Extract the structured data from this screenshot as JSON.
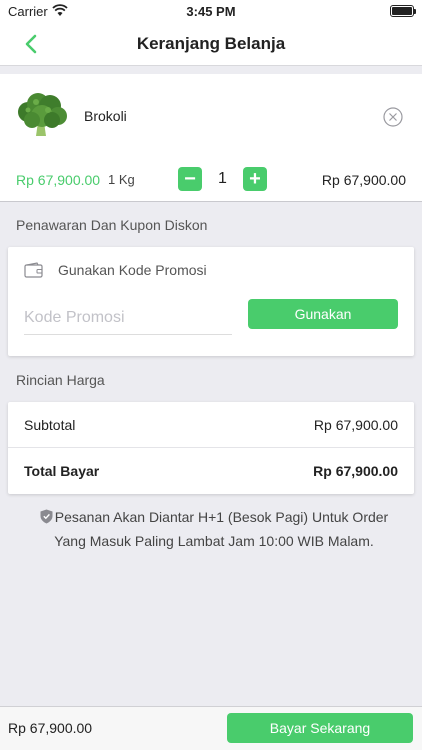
{
  "status_bar": {
    "carrier": "Carrier",
    "time": "3:45 PM",
    "wifi_icon": "wifi-icon",
    "battery_icon": "battery-icon"
  },
  "nav": {
    "title": "Keranjang Belanja",
    "back_icon": "chevron-left-icon"
  },
  "cart": {
    "items": [
      {
        "name": "Brokoli",
        "price": "Rp 67,900.00",
        "unit": "1 Kg",
        "quantity": "1",
        "line_total": "Rp 67,900.00",
        "decrease_label": "−",
        "increase_label": "+"
      }
    ]
  },
  "promo": {
    "section_title": "Penawaran Dan Kupon Diskon",
    "card_title": "Gunakan Kode Promosi",
    "input_value": "",
    "input_placeholder": "Kode Promosi",
    "apply_label": "Gunakan"
  },
  "pricing": {
    "section_title": "Rincian Harga",
    "subtotal_label": "Subtotal",
    "subtotal_value": "Rp 67,900.00",
    "total_label": "Total Bayar",
    "total_value": "Rp 67,900.00"
  },
  "delivery_note": "Pesanan Akan Diantar H+1 (Besok Pagi) Untuk Order Yang Masuk Paling Lambat Jam 10:00 WIB Malam.",
  "footer": {
    "grand_total": "Rp 67,900.00",
    "pay_label": "Bayar Sekarang"
  },
  "colors": {
    "accent": "#49cc6c",
    "background": "#ececf1"
  }
}
